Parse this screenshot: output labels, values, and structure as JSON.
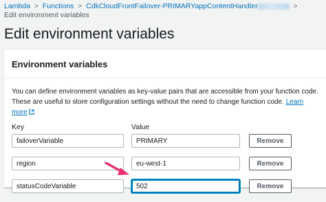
{
  "breadcrumb": {
    "items": [
      "Lambda",
      "Functions",
      "CdkCloudFrontFailover-PRIMARYappContentHandler"
    ],
    "current": "Edit environment variables"
  },
  "page": {
    "title": "Edit environment variables"
  },
  "panel": {
    "title": "Environment variables",
    "description": "You can define environment variables as key-value pairs that are accessible from your function code. These are useful to store configuration settings without the need to change function code.",
    "learn_more": "Learn more",
    "key_header": "Key",
    "value_header": "Value",
    "rows": [
      {
        "key": "failoverVariable",
        "value": "PRIMARY",
        "remove": "Remove"
      },
      {
        "key": "region",
        "value": "eu-west-1",
        "remove": "Remove"
      },
      {
        "key": "statusCodeVariable",
        "value": "502",
        "remove": "Remove"
      }
    ]
  },
  "colors": {
    "link": "#0073bb",
    "annotation_arrow": "#e8336e",
    "focus": "#0073bb"
  },
  "icons": [
    "chevron-right-icon",
    "external-link-icon",
    "annotation-arrow"
  ]
}
